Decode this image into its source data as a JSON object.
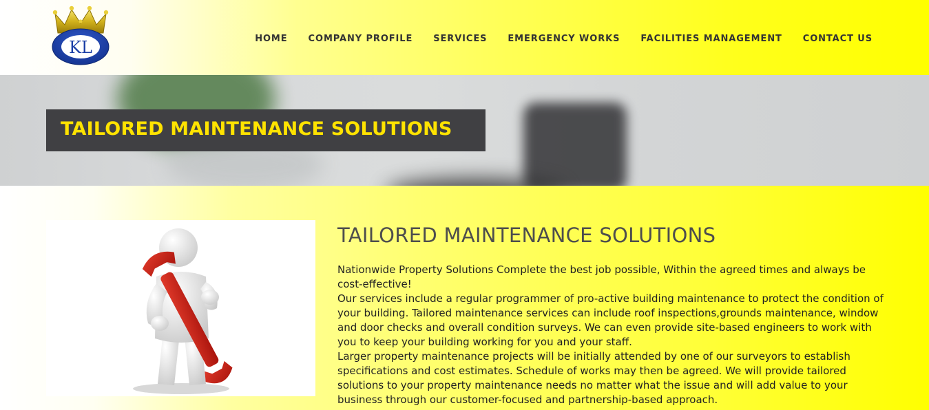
{
  "logo": {
    "text": "KL"
  },
  "nav": {
    "items": [
      {
        "label": "HOME"
      },
      {
        "label": "COMPANY PROFILE"
      },
      {
        "label": "SERVICES"
      },
      {
        "label": "EMERGENCY WORKS"
      },
      {
        "label": "FACILITIES MANAGEMENT"
      },
      {
        "label": "CONTACT US"
      }
    ]
  },
  "banner": {
    "title": "TAILORED MAINTENANCE SOLUTIONS"
  },
  "main": {
    "heading": "TAILORED MAINTENANCE SOLUTIONS",
    "paragraphs": [
      "Nationwide Property Solutions Complete the best job possible, Within the agreed times and always be cost-effective!",
      "Our services include a regular programmer of pro-active building maintenance to protect the condition of your building. Tailored maintenance services can include roof inspections,grounds maintenance, window and door checks and overall condition surveys. We can even provide site-based engineers to work with you to keep your building working for you and your staff.",
      "Larger property maintenance projects will be initially attended by one of our surveyors to establish specifications and cost estimates. Schedule of works may then be agreed. We will provide tailored solutions to your property maintenance needs no matter what the issue and will add value to your business through our customer-focused and partnership-based approach."
    ]
  },
  "colors": {
    "accent_yellow": "#ffff00",
    "banner_title": "#ffe300",
    "banner_box": "#404043",
    "nav_text": "#333333"
  },
  "icons": [
    "crown-icon",
    "wrench-figure-illustration"
  ]
}
